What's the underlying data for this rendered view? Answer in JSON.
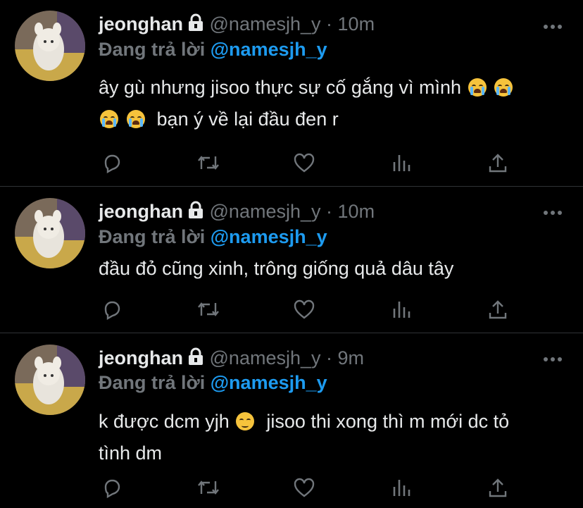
{
  "tweets": [
    {
      "name": "jeonghan",
      "handle": "@namesjh_y",
      "dot": "·",
      "time": "10m",
      "replying_prefix": "Đang trả lời",
      "replying_to": "@namesjh_y",
      "text_line1": "ây gù nhưng jisoo thực sự cố gắng vì mình",
      "text_line2": "bạn ý về lại đầu đen r"
    },
    {
      "name": "jeonghan",
      "handle": "@namesjh_y",
      "dot": "·",
      "time": "10m",
      "replying_prefix": "Đang trả lời",
      "replying_to": "@namesjh_y",
      "text_line1": "đầu đỏ cũng xinh, trông giống quả dâu tây"
    },
    {
      "name": "jeonghan",
      "handle": "@namesjh_y",
      "dot": "·",
      "time": "9m",
      "replying_prefix": "Đang trả lời",
      "replying_to": "@namesjh_y",
      "text_line1_a": "k được dcm yjh",
      "text_line1_b": "jisoo thi xong thì m mới dc tỏ",
      "text_line2": "tình dm"
    }
  ],
  "icons": [
    "lock-icon",
    "more-icon",
    "reply-icon",
    "retweet-icon",
    "like-icon",
    "views-icon",
    "share-icon",
    "loudly-crying-face-emoji",
    "pensive-face-emoji"
  ],
  "colors": {
    "background": "#000000",
    "text": "#e7e9ea",
    "secondary": "#71767b",
    "mention": "#1d9bf0",
    "divider": "#2f3336"
  }
}
